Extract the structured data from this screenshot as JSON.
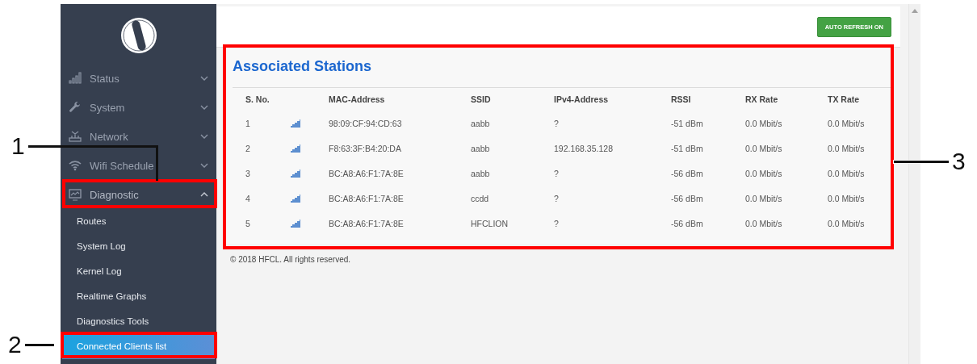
{
  "sidebar": {
    "items": [
      {
        "label": "Status",
        "expanded": false
      },
      {
        "label": "System",
        "expanded": false
      },
      {
        "label": "Network",
        "expanded": false
      },
      {
        "label": "Wifi Schedule",
        "expanded": false
      },
      {
        "label": "Diagnostic",
        "expanded": true,
        "children": [
          {
            "label": "Routes",
            "selected": false
          },
          {
            "label": "System Log",
            "selected": false
          },
          {
            "label": "Kernel Log",
            "selected": false
          },
          {
            "label": "Realtime Graphs",
            "selected": false
          },
          {
            "label": "Diagnostics Tools",
            "selected": false
          },
          {
            "label": "Connected Clients list",
            "selected": true
          }
        ]
      }
    ]
  },
  "toolbar": {
    "button": "AUTO REFRESH ON"
  },
  "panel": {
    "title": "Associated Stations",
    "table": {
      "columns": [
        "S. No.",
        "MAC-Address",
        "SSID",
        "IPv4-Address",
        "RSSI",
        "RX Rate",
        "TX Rate"
      ],
      "rows": [
        {
          "s_no": "1",
          "mac": "98:09:CF:94:CD:63",
          "ssid": "aabb",
          "ipv4": "?",
          "rssi": "-51 dBm",
          "rx": "0.0 Mbit/s",
          "tx": "0.0 Mbit/s"
        },
        {
          "s_no": "2",
          "mac": "F8:63:3F:B4:20:DA",
          "ssid": "aabb",
          "ipv4": "192.168.35.128",
          "rssi": "-51 dBm",
          "rx": "0.0 Mbit/s",
          "tx": "0.0 Mbit/s"
        },
        {
          "s_no": "3",
          "mac": "BC:A8:A6:F1:7A:8E",
          "ssid": "aabb",
          "ipv4": "?",
          "rssi": "-56 dBm",
          "rx": "0.0 Mbit/s",
          "tx": "0.0 Mbit/s"
        },
        {
          "s_no": "4",
          "mac": "BC:A8:A6:F1:7A:8E",
          "ssid": "ccdd",
          "ipv4": "?",
          "rssi": "-56 dBm",
          "rx": "0.0 Mbit/s",
          "tx": "0.0 Mbit/s"
        },
        {
          "s_no": "5",
          "mac": "BC:A8:A6:F1:7A:8E",
          "ssid": "HFCLION",
          "ipv4": "?",
          "rssi": "-56 dBm",
          "rx": "0.0 Mbit/s",
          "tx": "0.0 Mbit/s"
        }
      ]
    }
  },
  "footer": "© 2018 HFCL. All rights reserved.",
  "callouts": [
    {
      "label": "1"
    },
    {
      "label": "2"
    },
    {
      "label": "3"
    }
  ]
}
